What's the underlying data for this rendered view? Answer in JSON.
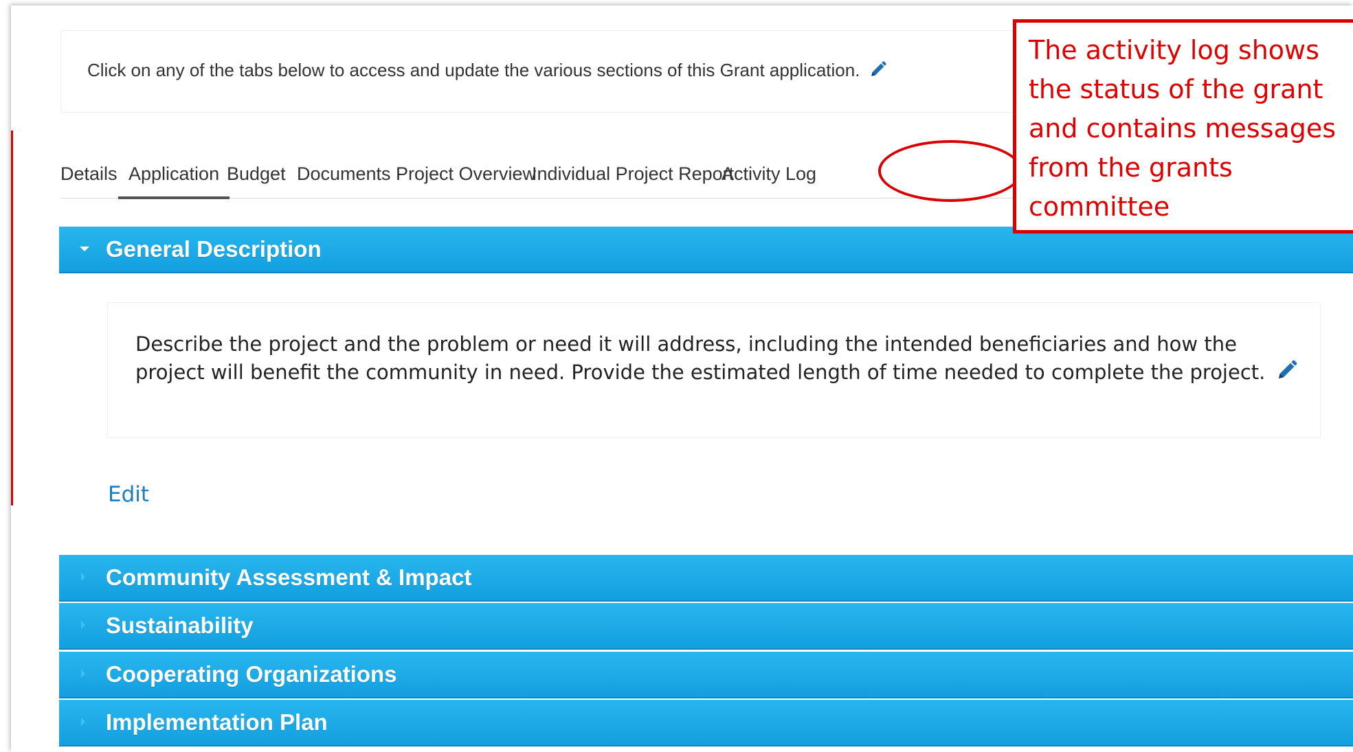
{
  "intro": {
    "text": "Click on any of the tabs below to access and update the various sections of this Grant application."
  },
  "tabs": [
    {
      "label": "Details"
    },
    {
      "label": "Application"
    },
    {
      "label": "Budget"
    },
    {
      "label": "Documents"
    },
    {
      "label": "Project Overview"
    },
    {
      "label": "Individual Project Report"
    },
    {
      "label": "Activity Log"
    }
  ],
  "active_tab": "Application",
  "annotation": {
    "lines": [
      "The activity log shows",
      "the status of the grant",
      "and contains messages",
      "from the grants",
      "committee"
    ]
  },
  "sections": [
    {
      "title": "General Description",
      "expanded": true
    },
    {
      "title": "Community Assessment & Impact",
      "expanded": false
    },
    {
      "title": "Sustainability",
      "expanded": false
    },
    {
      "title": "Cooperating Organizations",
      "expanded": false
    },
    {
      "title": "Implementation Plan",
      "expanded": false
    }
  ],
  "general_description": {
    "text": "Describe the project and the problem or need it will address, including the intended beneficiaries and how the project will benefit the community in need. Provide the estimated length of time needed to complete the project.",
    "edit_label": "Edit"
  },
  "colors": {
    "accent": "#1ba7e4",
    "annotation_red": "#d90000",
    "link": "#1a7fc1"
  }
}
